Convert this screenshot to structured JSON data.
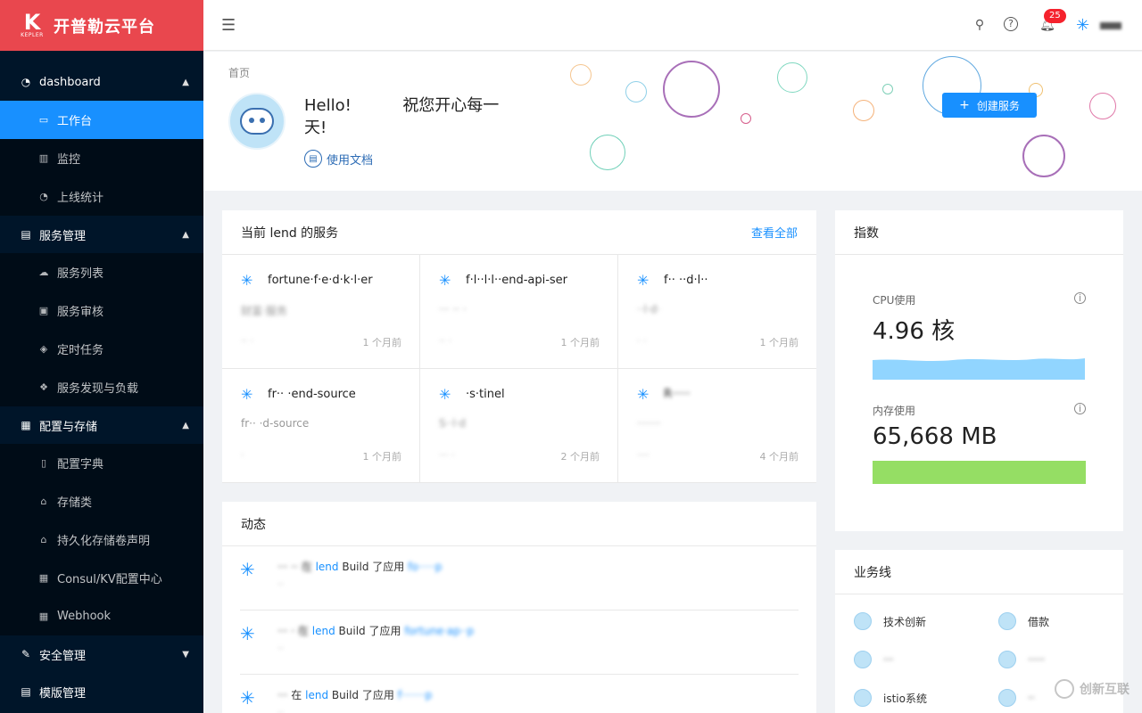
{
  "brand": {
    "logo_text": "K",
    "logo_sub": "KEPLER",
    "title": "开普勒云平台",
    "color": "#e9474e"
  },
  "sidebar": {
    "groups": [
      {
        "label": "dashboard",
        "icon": "gauge-icon",
        "expanded": true,
        "items": [
          {
            "label": "工作台",
            "icon": "monitor-icon",
            "active": true
          },
          {
            "label": "监控",
            "icon": "bar-chart-icon"
          },
          {
            "label": "上线统计",
            "icon": "gauge-icon"
          }
        ]
      },
      {
        "label": "服务管理",
        "icon": "list-icon",
        "expanded": true,
        "items": [
          {
            "label": "服务列表",
            "icon": "cloud-icon"
          },
          {
            "label": "服务审核",
            "icon": "audit-icon"
          },
          {
            "label": "定时任务",
            "icon": "tag-icon"
          },
          {
            "label": "服务发现与负载",
            "icon": "network-icon"
          }
        ]
      },
      {
        "label": "配置与存储",
        "icon": "table-icon",
        "expanded": true,
        "items": [
          {
            "label": "配置字典",
            "icon": "file-icon"
          },
          {
            "label": "存储类",
            "icon": "disk-icon"
          },
          {
            "label": "持久化存储卷声明",
            "icon": "disk-icon"
          },
          {
            "label": "Consul/KV配置中心",
            "icon": "table-icon"
          },
          {
            "label": "Webhook",
            "icon": "table-icon"
          }
        ]
      },
      {
        "label": "安全管理",
        "icon": "edit-icon",
        "expanded": false,
        "items": []
      },
      {
        "label": "模版管理",
        "icon": "template-icon",
        "expanded": false,
        "items": []
      }
    ]
  },
  "header": {
    "notification_count": "25"
  },
  "banner": {
    "breadcrumb": "首页",
    "greeting_prefix": "Hello!",
    "greeting_suffix": "祝您开心每一天!",
    "doc_link": "使用文档",
    "create_button": "创建服务"
  },
  "services_card": {
    "title": "当前 lend 的服务",
    "view_all": "查看全部",
    "services": [
      {
        "name": "fortune·f·e·d·k·l·er",
        "desc": "财富·服务",
        "owner": "·· ·",
        "time": "1 个月前"
      },
      {
        "name": "f·l··l·l··end-api-ser",
        "desc": "··· ·· ·",
        "owner": "·· ·",
        "time": "1 个月前"
      },
      {
        "name": "f·· ··d·l··",
        "desc": "··l·d·",
        "owner": "· ·",
        "time": "1 个月前"
      },
      {
        "name": "fr·· ·end-source",
        "desc": "fr·· ·d-source",
        "owner": "·",
        "time": "1 个月前"
      },
      {
        "name": "·s·tinel",
        "desc": "S··l·d",
        "owner": "··· ·",
        "time": "2 个月前"
      },
      {
        "name": "R·····",
        "desc": "·······",
        "owner": "····",
        "time": "4 个月前"
      }
    ]
  },
  "activity_card": {
    "title": "动态",
    "items": [
      {
        "actor": "··· ··",
        "action_pre": "在",
        "project": "lend",
        "action": "Build 了应用",
        "target": "fo·····p",
        "time": "··"
      },
      {
        "actor": "··· ·",
        "action_pre": "在",
        "project": "lend",
        "action": "Build 了应用",
        "target": "fortune·ap··p",
        "time": "··"
      },
      {
        "actor": "···",
        "action_pre": "在",
        "project": "lend",
        "action": "Build 了应用",
        "target": "f·······p",
        "time": "··"
      }
    ]
  },
  "metrics_card": {
    "title": "指数",
    "cpu": {
      "label": "CPU使用",
      "value": "4.96 核",
      "color": "#91d5ff"
    },
    "memory": {
      "label": "内存使用",
      "value": "65,668 MB",
      "color": "#95de64"
    }
  },
  "business_card": {
    "title": "业务线",
    "items": [
      {
        "label": "技术创新"
      },
      {
        "label": "借款"
      },
      {
        "label": "···"
      },
      {
        "label": "·····"
      },
      {
        "label": "istio系统"
      },
      {
        "label": "··"
      }
    ]
  },
  "watermark": {
    "text": "创新互联"
  }
}
